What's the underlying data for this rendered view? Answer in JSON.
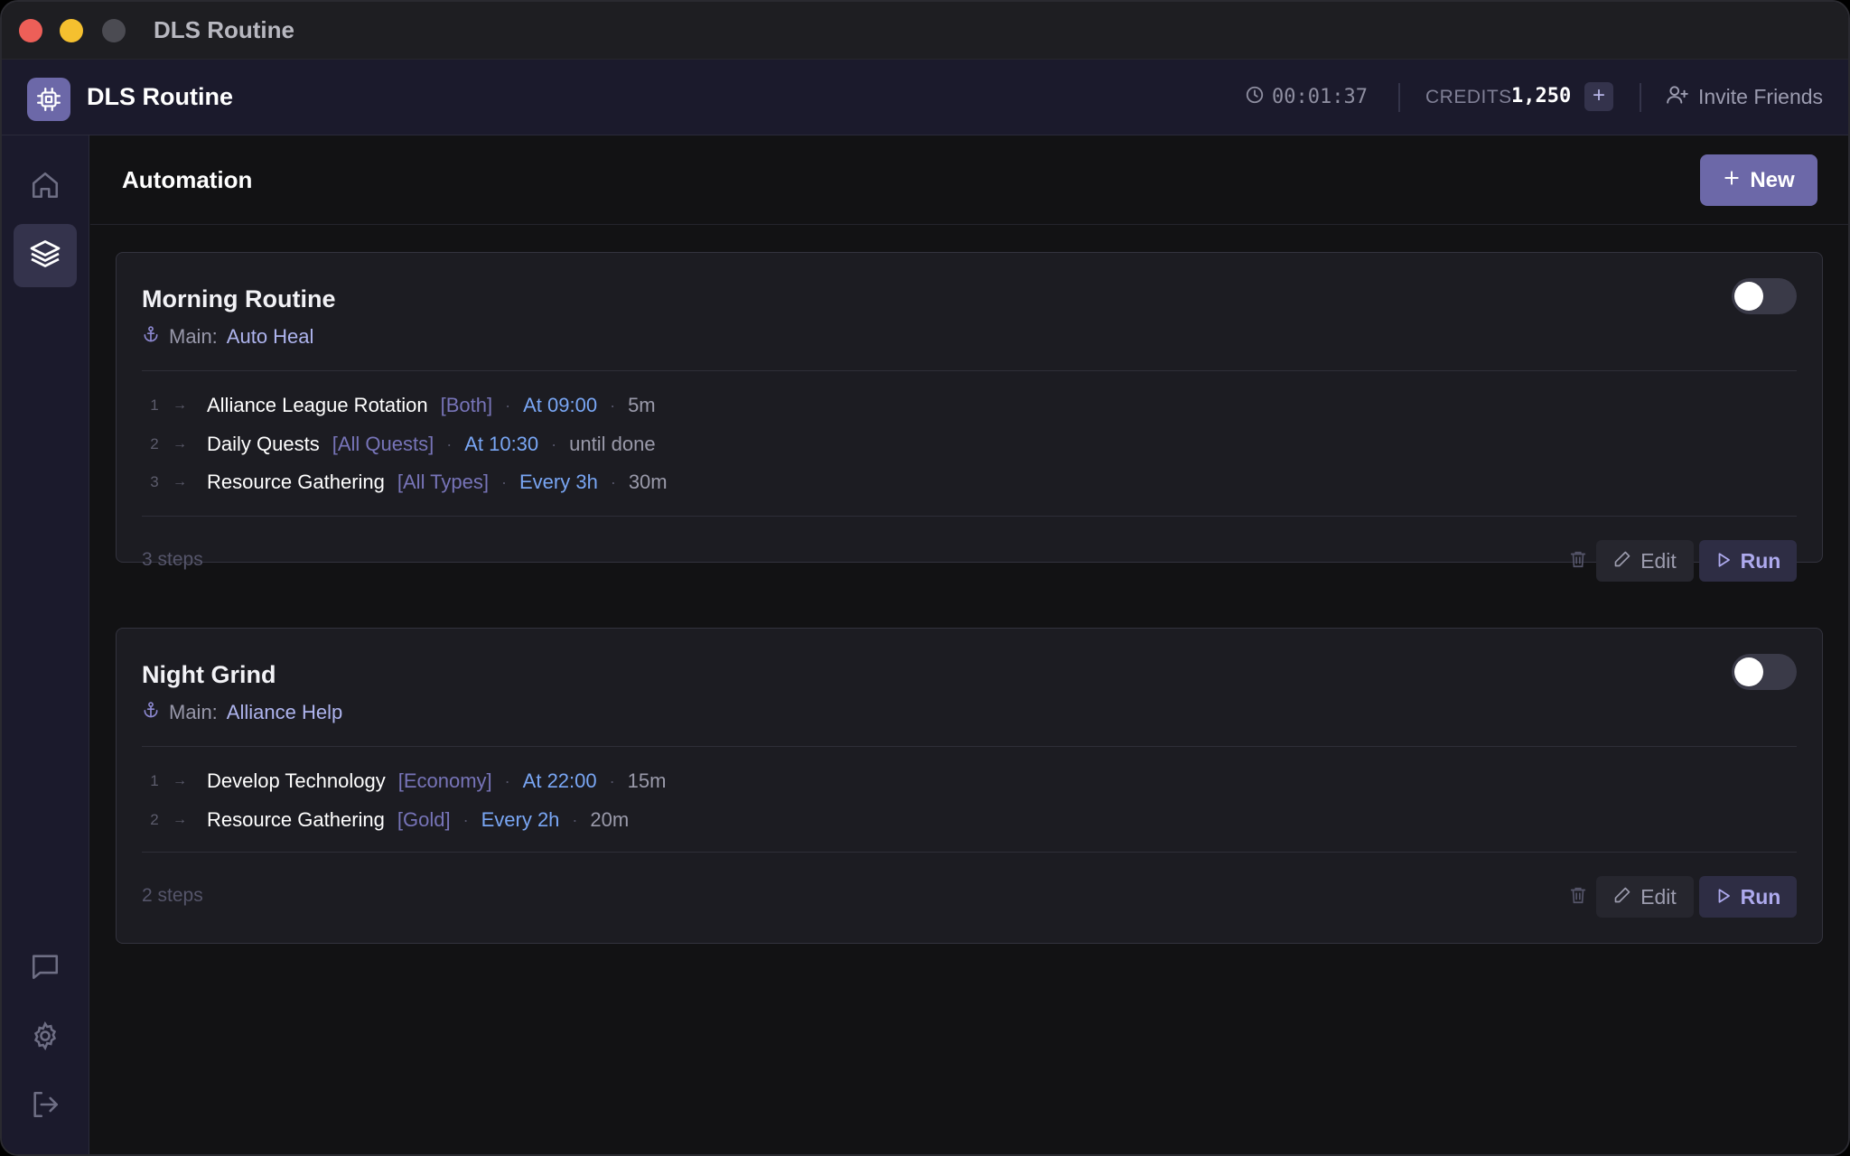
{
  "window": {
    "title": "DLS Routine"
  },
  "header": {
    "app_name": "DLS Routine",
    "timer": "00:01:37",
    "credits_label": "CREDITS",
    "credits_value": "1,250",
    "credits_add": "+",
    "invite_label": "Invite Friends"
  },
  "sidebar": {
    "items": [
      {
        "name": "home",
        "icon": "home-icon",
        "active": false
      },
      {
        "name": "automation",
        "icon": "layers-icon",
        "active": true
      },
      {
        "name": "chat",
        "icon": "chat-icon",
        "active": false
      },
      {
        "name": "settings",
        "icon": "gear-icon",
        "active": false
      },
      {
        "name": "logout",
        "icon": "logout-icon",
        "active": false
      }
    ]
  },
  "page": {
    "title": "Automation",
    "new_label": "New"
  },
  "routines": [
    {
      "title": "Morning Routine",
      "main_label": "Main:",
      "main_value": "Auto Heal",
      "enabled": false,
      "steps": [
        {
          "num": "1",
          "name": "Alliance League Rotation",
          "tag": "[Both]",
          "schedule": "At 09:00",
          "duration": "5m"
        },
        {
          "num": "2",
          "name": "Daily Quests",
          "tag": "[All Quests]",
          "schedule": "At 10:30",
          "duration": "until done"
        },
        {
          "num": "3",
          "name": "Resource Gathering",
          "tag": "[All Types]",
          "schedule": "Every 3h",
          "duration": "30m"
        }
      ],
      "steps_count": "3 steps",
      "edit_label": "Edit",
      "run_label": "Run"
    },
    {
      "title": "Night Grind",
      "main_label": "Main:",
      "main_value": "Alliance Help",
      "enabled": false,
      "steps": [
        {
          "num": "1",
          "name": "Develop Technology",
          "tag": "[Economy]",
          "schedule": "At 22:00",
          "duration": "15m"
        },
        {
          "num": "2",
          "name": "Resource Gathering",
          "tag": "[Gold]",
          "schedule": "Every 2h",
          "duration": "20m"
        }
      ],
      "steps_count": "2 steps",
      "edit_label": "Edit",
      "run_label": "Run"
    }
  ],
  "colors": {
    "accent": "#6c68a8",
    "schedule": "#79a6f4",
    "tag": "#7774b8",
    "main_value": "#aeb4ee"
  }
}
